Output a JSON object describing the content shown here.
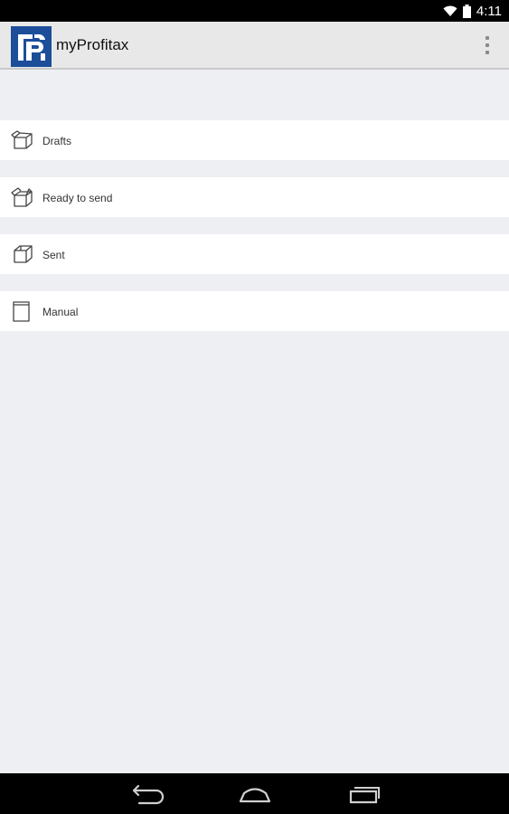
{
  "status_bar": {
    "time": "4:11",
    "icons": [
      "wifi-icon",
      "battery-icon"
    ]
  },
  "action_bar": {
    "title": "myProfitax",
    "logo": "myprofitax-logo",
    "overflow_icon": "more-vert-icon"
  },
  "menu": {
    "items": [
      {
        "label": "Drafts",
        "icon": "open-box-icon"
      },
      {
        "label": "Ready to send",
        "icon": "box-icon"
      },
      {
        "label": "Sent",
        "icon": "closed-box-icon"
      },
      {
        "label": "Manual",
        "icon": "document-icon"
      }
    ]
  },
  "nav_bar": {
    "buttons": [
      "back-icon",
      "home-icon",
      "recents-icon"
    ]
  },
  "colors": {
    "action_bar": "#e8e8e8",
    "logo": "#1c4e9a",
    "background": "#eeeff3"
  }
}
